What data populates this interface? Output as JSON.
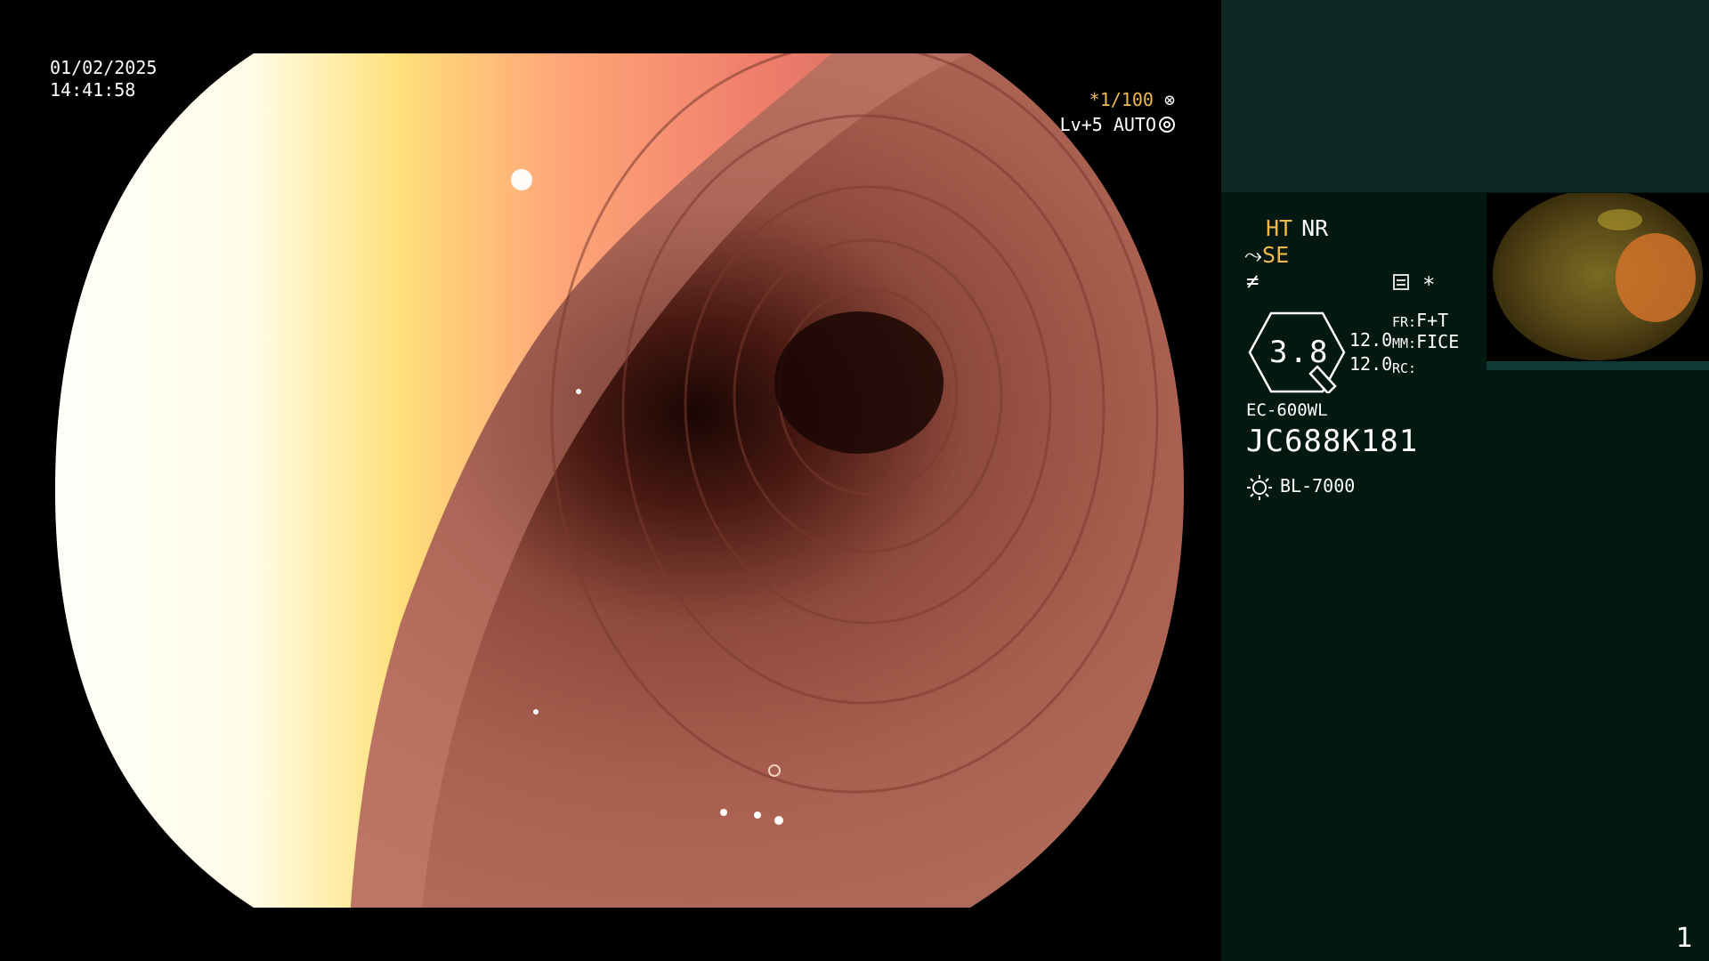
{
  "overlay": {
    "date": "01/02/2025",
    "time": "14:41:58",
    "shutter": "*1/100",
    "light_level": "Lv+5",
    "light_mode": "AUTO"
  },
  "panel": {
    "ht": "HT",
    "nr": "NR",
    "se": "SE",
    "star": "*",
    "zoom_value": "3.8",
    "value_1": "12.0",
    "value_2": "12.0",
    "fr_label": "FR:",
    "fr_value": "F+T",
    "mm_label": "MM:",
    "mm_value": "FICE",
    "rc_label": "RC:",
    "scope_model": "EC-600WL",
    "scope_serial": "JC688K181",
    "light_source": "BL-7000",
    "page_number": "1"
  },
  "icons": {
    "shutter": "aperture-icon",
    "light": "ring-icon",
    "se": "scope-tip-icon",
    "slash": "not-equal-icon",
    "settings": "menu-box-icon",
    "zoom": "hexagon-badge-icon",
    "light_source": "sun-icon"
  },
  "colors": {
    "panel_bg": "#021812",
    "panel_top_bg": "#0f2722",
    "accent_amber": "#f0b848",
    "text": "#ffffff"
  }
}
